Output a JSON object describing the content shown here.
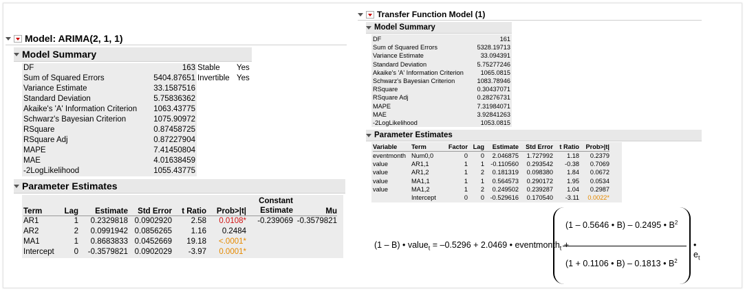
{
  "left": {
    "title": "Model: ARIMA(2, 1, 1)",
    "summary_title": "Model Summary",
    "summary_rows": [
      {
        "label": "DF",
        "value": "163"
      },
      {
        "label": "Sum of Squared Errors",
        "value": "5404.87651"
      },
      {
        "label": "Variance Estimate",
        "value": "33.1587516"
      },
      {
        "label": "Standard Deviation",
        "value": "5.75836362"
      },
      {
        "label": "Akaike's 'A' Information Criterion",
        "value": "1063.43775"
      },
      {
        "label": "Schwarz's Bayesian Criterion",
        "value": "1075.90972"
      },
      {
        "label": "RSquare",
        "value": "0.87458725"
      },
      {
        "label": "RSquare Adj",
        "value": "0.87227904"
      },
      {
        "label": "MAPE",
        "value": "7.41450804"
      },
      {
        "label": "MAE",
        "value": "4.01638459"
      },
      {
        "label": "-2LogLikelihood",
        "value": "1055.43775"
      }
    ],
    "side": [
      {
        "label": "Stable",
        "value": "Yes"
      },
      {
        "label": "Invertible",
        "value": "Yes"
      }
    ],
    "param_title": "Parameter Estimates",
    "param_headers": {
      "term": "Term",
      "lag": "Lag",
      "estimate": "Estimate",
      "stderr": "Std Error",
      "tratio": "t Ratio",
      "prob": "Prob>|t|",
      "const1": "Constant",
      "const2": "Estimate",
      "mu": "Mu"
    },
    "params": [
      {
        "term": "AR1",
        "lag": "1",
        "estimate": "0.2329818",
        "stderr": "0.0902920",
        "tratio": "2.58",
        "prob": "0.0108*",
        "prob_color": "red"
      },
      {
        "term": "AR2",
        "lag": "2",
        "estimate": "0.0991942",
        "stderr": "0.0856265",
        "tratio": "1.16",
        "prob": "0.2484",
        "prob_color": "black"
      },
      {
        "term": "MA1",
        "lag": "1",
        "estimate": "0.8683833",
        "stderr": "0.0452669",
        "tratio": "19.18",
        "prob": "<.0001*",
        "prob_color": "orange"
      },
      {
        "term": "Intercept",
        "lag": "0",
        "estimate": "-0.3579821",
        "stderr": "0.0902029",
        "tratio": "-3.97",
        "prob": "0.0001*",
        "prob_color": "orange"
      }
    ],
    "constant_estimate": "-0.239069",
    "mu": "-0.3579821"
  },
  "right": {
    "title": "Transfer Function Model (1)",
    "summary_title": "Model Summary",
    "summary_rows": [
      {
        "label": "DF",
        "value": "161"
      },
      {
        "label": "Sum of Squared Errors",
        "value": "5328.19713"
      },
      {
        "label": "Variance Estimate",
        "value": "33.094391"
      },
      {
        "label": "Standard Deviation",
        "value": "5.75277246"
      },
      {
        "label": "Akaike's 'A' Information Criterion",
        "value": "1065.0815"
      },
      {
        "label": "Schwarz's Bayesian Criterion",
        "value": "1083.78946"
      },
      {
        "label": "RSquare",
        "value": "0.30437071"
      },
      {
        "label": "RSquare Adj",
        "value": "0.28276731"
      },
      {
        "label": "MAPE",
        "value": "7.31984071"
      },
      {
        "label": "MAE",
        "value": "3.92841263"
      },
      {
        "label": "-2LogLikelihood",
        "value": "1053.0815"
      }
    ],
    "param_title": "Parameter Estimates",
    "param_headers": {
      "variable": "Variable",
      "term": "Term",
      "factor": "Factor",
      "lag": "Lag",
      "estimate": "Estimate",
      "stderr": "Std Error",
      "tratio": "t Ratio",
      "prob": "Prob>|t|"
    },
    "params": [
      {
        "variable": "eventmonth",
        "term": "Num0,0",
        "factor": "0",
        "lag": "0",
        "estimate": "2.046875",
        "stderr": "1.727992",
        "tratio": "1.18",
        "prob": "0.2379",
        "prob_color": "black"
      },
      {
        "variable": "value",
        "term": "AR1,1",
        "factor": "1",
        "lag": "1",
        "estimate": "-0.110560",
        "stderr": "0.293542",
        "tratio": "-0.38",
        "prob": "0.7069",
        "prob_color": "black"
      },
      {
        "variable": "value",
        "term": "AR1,2",
        "factor": "1",
        "lag": "2",
        "estimate": "0.181319",
        "stderr": "0.098380",
        "tratio": "1.84",
        "prob": "0.0672",
        "prob_color": "black"
      },
      {
        "variable": "value",
        "term": "MA1,1",
        "factor": "1",
        "lag": "1",
        "estimate": "0.564573",
        "stderr": "0.290172",
        "tratio": "1.95",
        "prob": "0.0534",
        "prob_color": "black"
      },
      {
        "variable": "value",
        "term": "MA1,2",
        "factor": "1",
        "lag": "2",
        "estimate": "0.249502",
        "stderr": "0.239287",
        "tratio": "1.04",
        "prob": "0.2987",
        "prob_color": "black"
      },
      {
        "variable": "",
        "term": "Intercept",
        "factor": "0",
        "lag": "0",
        "estimate": "-0.529616",
        "stderr": "0.170540",
        "tratio": "-3.11",
        "prob": "0.0022*",
        "prob_color": "orange"
      }
    ],
    "formula": {
      "lhs": "(1 – B) • value",
      "lhs_sub": "t",
      "rhs1": "= –0.5296 + 2.0469 • eventmonth",
      "rhs1_sub": "t",
      "plus": "+",
      "num": "(1 – 0.5646 • B) – 0.2495 • B",
      "num_sup": "2",
      "den": "(1 + 0.1106 • B) – 0.1813 • B",
      "den_sup": "2",
      "tail": "• e",
      "tail_sub": "t"
    }
  }
}
